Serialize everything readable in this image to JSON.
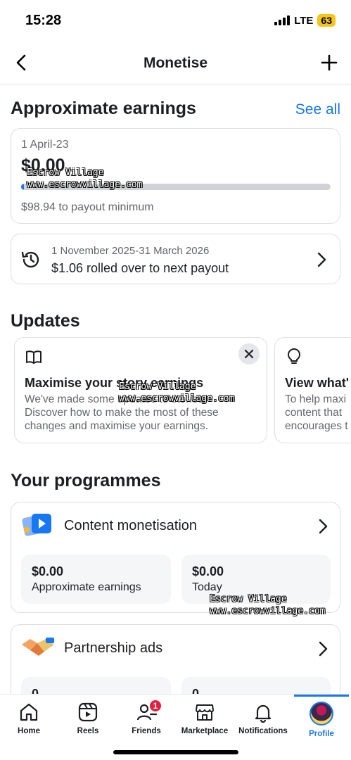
{
  "status_bar": {
    "time": "15:28",
    "network": "LTE",
    "battery": "63"
  },
  "header": {
    "title": "Monetise"
  },
  "earnings": {
    "section_title": "Approximate earnings",
    "see_all": "See all",
    "date_range": "1 April-23",
    "amount": "$0.00",
    "progress_fraction": 0.01,
    "payout_min_text": "$98.94 to payout minimum"
  },
  "rollover": {
    "date_range": "1 November 2025-31 March 2026",
    "text": "$1.06 rolled over to next payout"
  },
  "updates": {
    "section_title": "Updates",
    "cards": [
      {
        "icon": "book-icon",
        "title": "Maximise your story earnings",
        "body": "We've made some updates to stories.\nDiscover how to make the most of these\nchanges and maximise your earnings."
      },
      {
        "icon": "lightbulb-icon",
        "title": "View what'",
        "body": "To help maxi\ncontent that\nencourages t"
      }
    ]
  },
  "programmes": {
    "section_title": "Your programmes",
    "items": [
      {
        "title": "Content monetisation",
        "icon": "content-monetisation-icon",
        "stats": [
          {
            "value": "$0.00",
            "label": "Approximate earnings"
          },
          {
            "value": "$0.00",
            "label": "Today"
          }
        ]
      },
      {
        "title": "Partnership ads",
        "icon": "handshake-icon",
        "stats": [
          {
            "value": "0"
          },
          {
            "value": "0"
          }
        ]
      }
    ]
  },
  "watermark": {
    "line1": "Escrow Village",
    "line2": "www.escrowvillage.com"
  },
  "tabs": [
    {
      "label": "Home",
      "icon": "home-icon"
    },
    {
      "label": "Reels",
      "icon": "reels-icon"
    },
    {
      "label": "Friends",
      "icon": "friends-icon",
      "badge": "1"
    },
    {
      "label": "Marketplace",
      "icon": "marketplace-icon"
    },
    {
      "label": "Notifications",
      "icon": "bell-icon"
    },
    {
      "label": "Profile",
      "icon": "avatar",
      "active": true
    }
  ],
  "colors": {
    "accent": "#1877f2",
    "badge": "#e41e3f",
    "battery": "#f5c518"
  }
}
